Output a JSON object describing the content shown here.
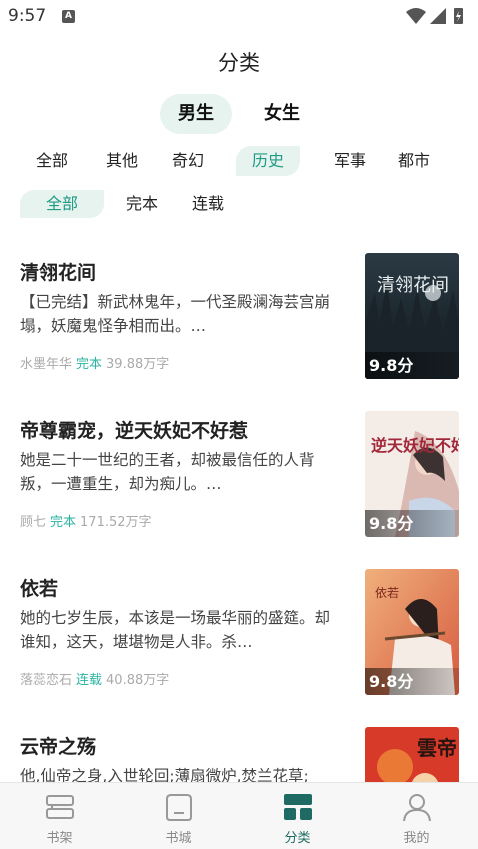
{
  "status_bar": {
    "time": "9:57",
    "notice": "A"
  },
  "page": {
    "title": "分类"
  },
  "gender_tabs": [
    {
      "label": "男生",
      "active": true
    },
    {
      "label": "女生",
      "active": false
    }
  ],
  "categories": [
    {
      "label": "全部",
      "active": false
    },
    {
      "label": "其他",
      "active": false
    },
    {
      "label": "奇幻",
      "active": false
    },
    {
      "label": "历史",
      "active": true
    },
    {
      "label": "军事",
      "active": false
    },
    {
      "label": "都市",
      "active": false
    }
  ],
  "status_filters": [
    {
      "label": "全部",
      "active": true
    },
    {
      "label": "完本",
      "active": false
    },
    {
      "label": "连载",
      "active": false
    }
  ],
  "books": [
    {
      "title": "清翎花间",
      "desc": "【已完结】新武林鬼年，一代圣殿澜海芸宫崩塌，妖魔鬼怪争相而出。…",
      "author": "水墨年华",
      "status": "完本",
      "words": "39.88万字",
      "score": "9.8分",
      "cover_text": "清翎花间"
    },
    {
      "title": "帝尊霸宠，逆天妖妃不好惹",
      "desc": "她是二十一世纪的王者，却被最信任的人背叛，一遭重生，却为痴儿。…",
      "author": "顾七",
      "status": "完本",
      "words": "171.52万字",
      "score": "9.8分",
      "cover_text": "逆天妖妃不好惹"
    },
    {
      "title": "依若",
      "desc": "她的七岁生辰，本该是一场最华丽的盛筵。却谁知，这天，堪堪物是人非。杀…",
      "author": "落蕊恋石",
      "status": "连载",
      "words": "40.88万字",
      "score": "9.8分",
      "cover_text": "依若"
    },
    {
      "title": "云帝之殇",
      "desc": "他,仙帝之身,入世轮回;薄扇微炉,焚兰花草;",
      "author": "",
      "status": "",
      "words": "",
      "score": "",
      "cover_text": "雲帝"
    }
  ],
  "bottom_nav": [
    {
      "label": "书架",
      "icon": "bookshelf-icon",
      "active": false
    },
    {
      "label": "书城",
      "icon": "bookstore-icon",
      "active": false
    },
    {
      "label": "分类",
      "icon": "category-icon",
      "active": true
    },
    {
      "label": "我的",
      "icon": "profile-icon",
      "active": false
    }
  ],
  "colors": {
    "accent": "#1f9a84",
    "accent_bg": "#e6f3ef",
    "status_text": "#2bb3a3",
    "nav_active": "#1f6b63"
  }
}
